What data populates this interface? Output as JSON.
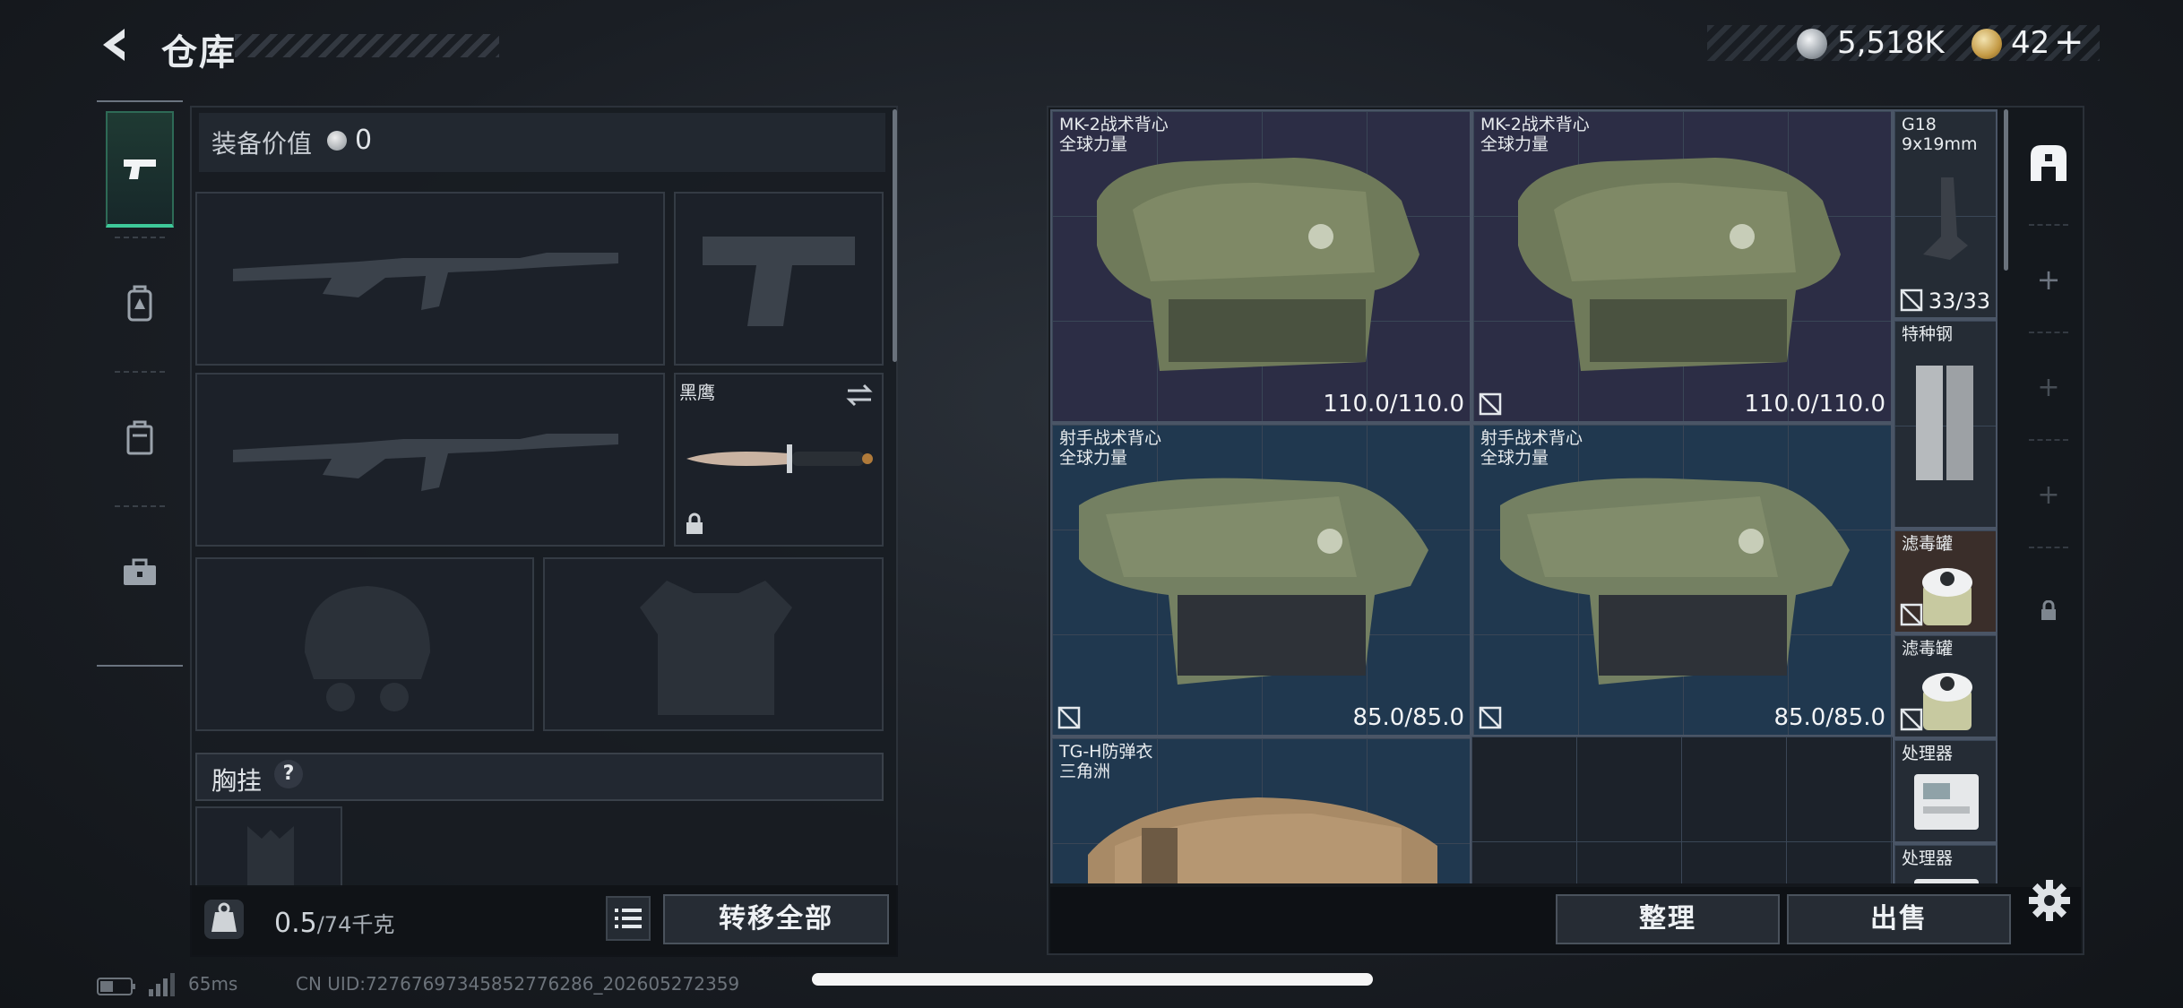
{
  "header": {
    "title": "仓库",
    "currency_main": "5,518K",
    "currency_premium": "42",
    "plus_label": "+"
  },
  "left_nav": {
    "items": [
      {
        "name": "weapons-tab",
        "icon": "pistol-icon",
        "active": true
      },
      {
        "name": "backpack-tab",
        "icon": "backpack-icon",
        "active": false
      },
      {
        "name": "case-tab",
        "icon": "case-icon",
        "active": false
      },
      {
        "name": "toolbox-tab",
        "icon": "toolbox-icon",
        "active": false
      }
    ]
  },
  "equipment": {
    "value_label": "装备价值",
    "value_amount": "0",
    "melee_name": "黑鹰",
    "chest_rig_label": "胸挂",
    "chest_rig_help": "?",
    "weight_current": "0.5",
    "weight_max": "/74千克",
    "transfer_all": "转移全部"
  },
  "stash": {
    "items": [
      {
        "name": "MK-2战术背心",
        "sub": "全球力量",
        "durability": "110.0/110.0",
        "rarity": "purple"
      },
      {
        "name": "MK-2战术背心",
        "sub": "全球力量",
        "durability": "110.0/110.0",
        "rarity": "purple"
      },
      {
        "name": "G18",
        "sub": "9x19mm",
        "count": "33/33",
        "rarity": "grey"
      },
      {
        "name": "特种钢",
        "sub": "",
        "rarity": "grey"
      },
      {
        "name": "射手战术背心",
        "sub": "全球力量",
        "durability": "85.0/85.0",
        "rarity": "blue"
      },
      {
        "name": "射手战术背心",
        "sub": "全球力量",
        "durability": "85.0/85.0",
        "rarity": "blue"
      },
      {
        "name": "滤毒罐",
        "sub": "",
        "rarity": "brown"
      },
      {
        "name": "滤毒罐",
        "sub": "",
        "rarity": "grey"
      },
      {
        "name": "TG-H防弹衣",
        "sub": "三角洲",
        "rarity": "blue"
      },
      {
        "name": "处理器",
        "sub": "",
        "rarity": "grey"
      },
      {
        "name": "处理器",
        "sub": "",
        "rarity": "grey"
      }
    ],
    "sort_label": "整理",
    "sell_label": "出售"
  },
  "status_bar": {
    "ping": "65ms",
    "uid": "CN UID:72767697345852776286_202605272359"
  },
  "colors": {
    "accent": "#3ec99a",
    "purple_rarity": "#2c2d45",
    "blue_rarity": "#20384f",
    "brown_rarity": "#3a2e2a"
  }
}
